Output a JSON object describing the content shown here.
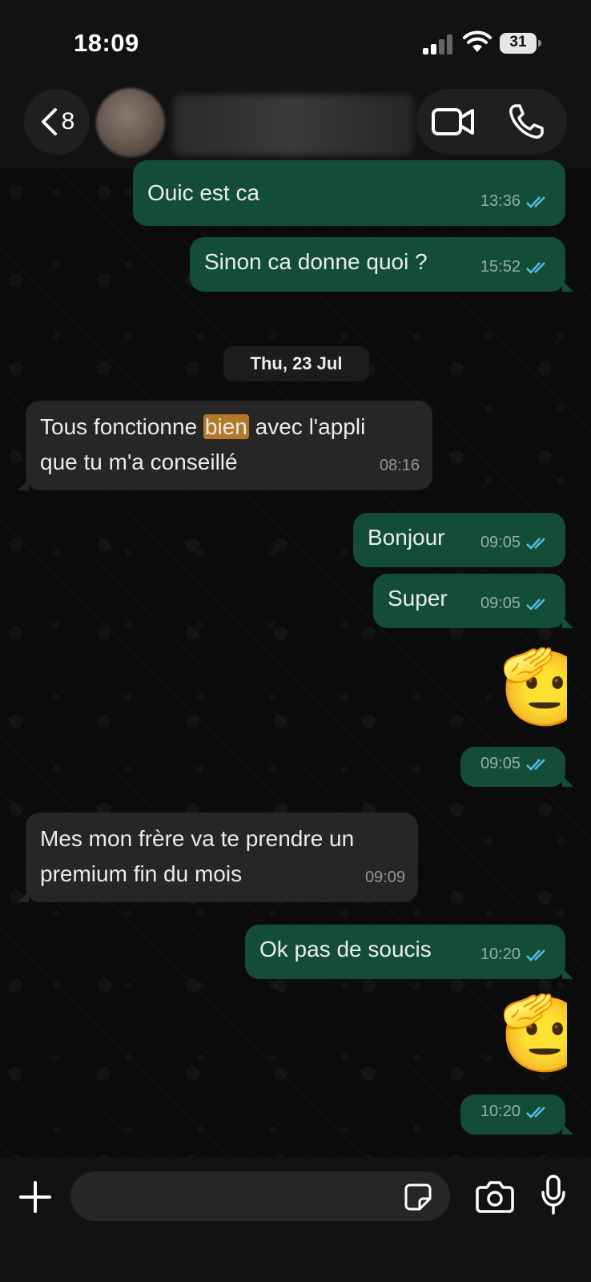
{
  "status_bar": {
    "time": "18:09",
    "battery": "31"
  },
  "header": {
    "back_count": "8",
    "contact_name": ""
  },
  "colors": {
    "outgoing_bubble": "#144d37",
    "incoming_bubble": "#262626",
    "read_ticks": "#53bdeb",
    "highlight": "#b47829"
  },
  "messages": [
    {
      "direction": "out",
      "text": "Ouic est ca",
      "time": "13:36",
      "status": "read"
    },
    {
      "direction": "out",
      "text": "Sinon ca donne quoi ?",
      "time": "15:52",
      "status": "read"
    },
    {
      "date_separator": "Thu, 23 Jul"
    },
    {
      "direction": "in",
      "text_parts": [
        "Tous fonctionne ",
        "bien",
        " avec l'appli"
      ],
      "text_line2": "que tu m'a conseillé",
      "time": "08:16"
    },
    {
      "direction": "out",
      "text": "Bonjour",
      "time": "09:05",
      "status": "read"
    },
    {
      "direction": "out",
      "text": "Super",
      "time": "09:05",
      "status": "read"
    },
    {
      "direction": "out",
      "emoji": "🫡",
      "time": "09:05",
      "status": "read"
    },
    {
      "direction": "in",
      "text": "Mes mon frère va te prendre un",
      "text_line2": "premium fin du mois",
      "time": "09:09"
    },
    {
      "direction": "out",
      "text": "Ok pas de soucis",
      "time": "10:20",
      "status": "read"
    },
    {
      "direction": "out",
      "emoji": "🫡",
      "time": "10:20",
      "status": "read"
    }
  ],
  "composer": {
    "placeholder": ""
  },
  "icons": [
    "back-chevron-icon",
    "video-call-icon",
    "voice-call-icon",
    "plus-icon",
    "sticker-icon",
    "camera-icon",
    "microphone-icon",
    "read-ticks-icon"
  ]
}
